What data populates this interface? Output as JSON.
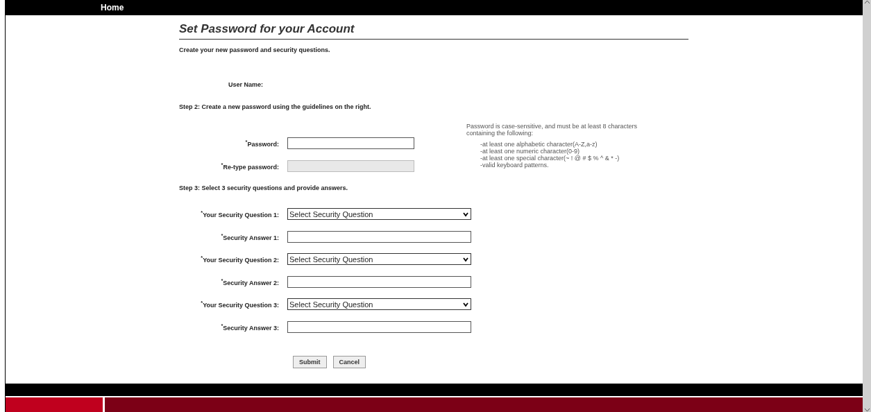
{
  "nav": {
    "home": "Home"
  },
  "title": "Set Password for your Account",
  "intro": "Create your new password and security questions.",
  "user_name": {
    "label": "User Name:"
  },
  "step2": "Step 2: Create a new password using the guidelines on the right.",
  "password_fields": [
    {
      "label": "$^{*}$Password:",
      "kind": "text",
      "disabled": false
    },
    {
      "label": "$^{*}$Re-type password:",
      "kind": "text",
      "disabled": true
    }
  ],
  "step3": "Step 3: Select 3 security questions and provide answers.",
  "security_fields": [
    {
      "label": "$^{*}$Your Security Question 1:",
      "kind": "select",
      "value": "Select Security Question"
    },
    {
      "label": "$^{*}$Security Answer 1:",
      "kind": "text"
    },
    {
      "label": "$^{*}$Your Security Question 2:",
      "kind": "select",
      "value": "Select Security Question"
    },
    {
      "label": "$^{*}$Security Answer 2:",
      "kind": "text"
    },
    {
      "label": "$^{*}$Your Security Question 3:",
      "kind": "select",
      "value": "Select Security Question"
    },
    {
      "label": "$^{*}$Security Answer 3:",
      "kind": "text"
    }
  ],
  "guidelines": {
    "intro": "Password is case-sensitive, and must be at least 8 characters containing the following:",
    "items": [
      "-at least one alphabetic character(A-Z,a-z)",
      "-at least one numeric character(0-9)",
      "-at least one special character(~ ! @ # $ % ^ & * -)",
      "-valid keyboard patterns."
    ]
  },
  "buttons": [
    "Submit",
    "Cancel"
  ]
}
